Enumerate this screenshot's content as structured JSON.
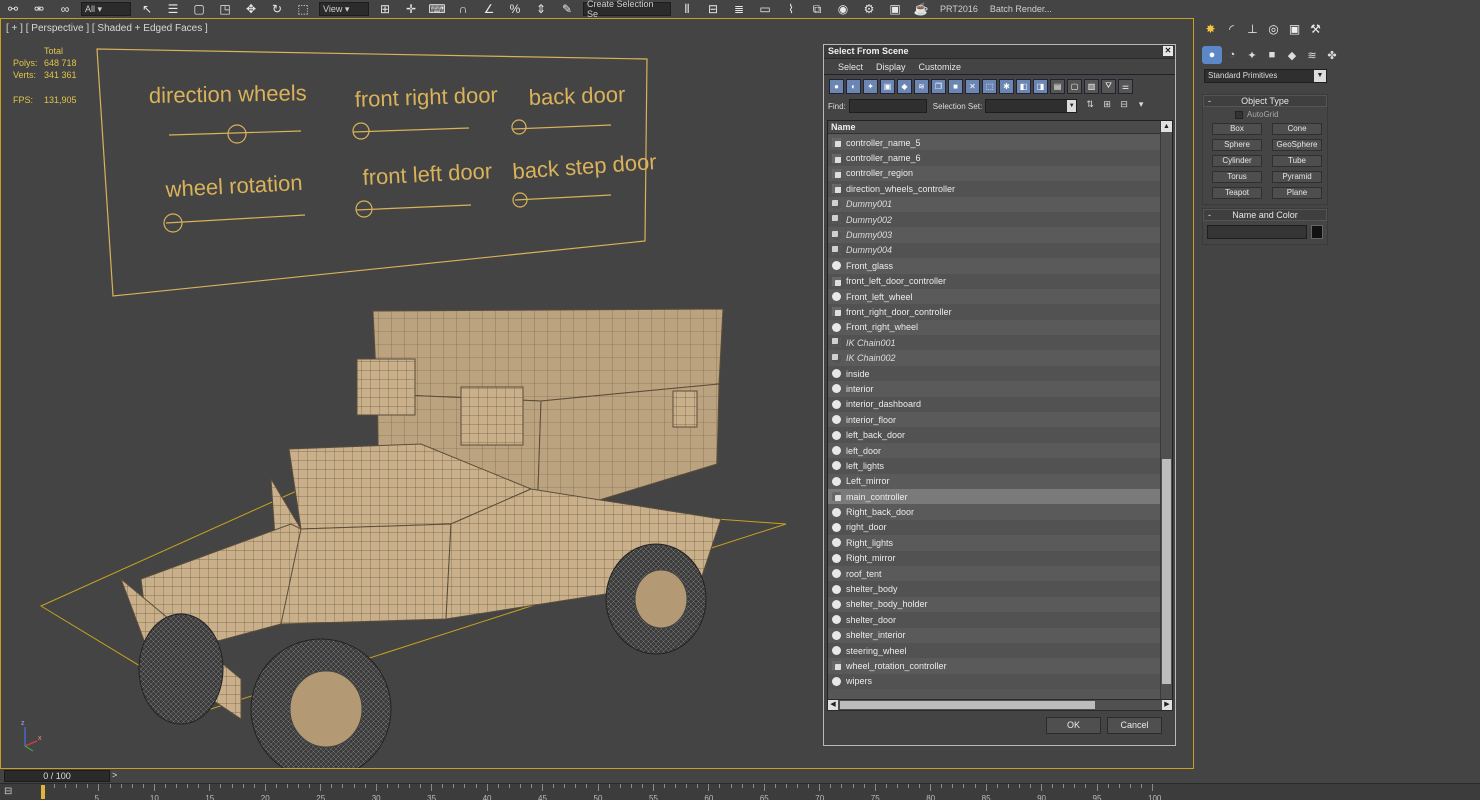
{
  "toolbar": {
    "view_dropdown": "View",
    "selection_set_placeholder": "Create Selection Se",
    "plugin_label": "PRT2016",
    "batch_render_label": "Batch Render..."
  },
  "viewport": {
    "label": "[ + ] [ Perspective ] [ Shaded + Edged Faces ]",
    "stats": {
      "total_label": "Total",
      "polys_label": "Polys:",
      "polys_value": "648 718",
      "verts_label": "Verts:",
      "verts_value": "341 361",
      "fps_label": "FPS:",
      "fps_value": "131,905"
    },
    "control_panel_labels": [
      "direction wheels",
      "front right door",
      "back door",
      "wheel rotation",
      "front left door",
      "back step door"
    ],
    "axis_labels": {
      "z": "z",
      "x": "x"
    }
  },
  "time_slider": {
    "frame_display": "0 / 100",
    "next_arrow": ">",
    "ticks": [
      "5",
      "10",
      "15",
      "20",
      "25",
      "30",
      "35",
      "40",
      "45",
      "50",
      "55",
      "60",
      "65",
      "70",
      "75",
      "80",
      "85",
      "90",
      "95",
      "100"
    ]
  },
  "command_panel": {
    "category_dropdown": "Standard Primitives",
    "object_type_title": "Object Type",
    "autogrid_label": "AutoGrid",
    "primitives": [
      "Box",
      "Cone",
      "Sphere",
      "GeoSphere",
      "Cylinder",
      "Tube",
      "Torus",
      "Pyramid",
      "Teapot",
      "Plane"
    ],
    "name_color_title": "Name and Color",
    "color_swatch": "#111111"
  },
  "dialog": {
    "title": "Select From Scene",
    "menu": [
      "Select",
      "Display",
      "Customize"
    ],
    "find_label": "Find:",
    "find_value": "",
    "selection_set_label": "Selection Set:",
    "column_header": "Name",
    "items": [
      {
        "name": "controller_name_5",
        "type": "ctrl"
      },
      {
        "name": "controller_name_6",
        "type": "ctrl"
      },
      {
        "name": "controller_region",
        "type": "ctrl"
      },
      {
        "name": "direction_wheels_controller",
        "type": "ctrl"
      },
      {
        "name": "Dummy001",
        "type": "dummy"
      },
      {
        "name": "Dummy002",
        "type": "dummy"
      },
      {
        "name": "Dummy003",
        "type": "dummy"
      },
      {
        "name": "Dummy004",
        "type": "dummy"
      },
      {
        "name": "Front_glass",
        "type": "mesh"
      },
      {
        "name": "front_left_door_controller",
        "type": "ctrl"
      },
      {
        "name": "Front_left_wheel",
        "type": "mesh"
      },
      {
        "name": "front_right_door_controller",
        "type": "ctrl"
      },
      {
        "name": "Front_right_wheel",
        "type": "mesh"
      },
      {
        "name": "IK Chain001",
        "type": "dummy"
      },
      {
        "name": "IK Chain002",
        "type": "dummy"
      },
      {
        "name": "inside",
        "type": "mesh"
      },
      {
        "name": "interior",
        "type": "mesh"
      },
      {
        "name": "interior_dashboard",
        "type": "mesh"
      },
      {
        "name": "interior_floor",
        "type": "mesh"
      },
      {
        "name": "left_back_door",
        "type": "mesh"
      },
      {
        "name": "left_door",
        "type": "mesh"
      },
      {
        "name": "left_lights",
        "type": "mesh"
      },
      {
        "name": "Left_mirror",
        "type": "mesh"
      },
      {
        "name": "main_controller",
        "type": "ctrl",
        "selected": true
      },
      {
        "name": "Right_back_door",
        "type": "mesh"
      },
      {
        "name": "right_door",
        "type": "mesh"
      },
      {
        "name": "Right_lights",
        "type": "mesh"
      },
      {
        "name": "Right_mirror",
        "type": "mesh"
      },
      {
        "name": "roof_tent",
        "type": "mesh"
      },
      {
        "name": "shelter_body",
        "type": "mesh"
      },
      {
        "name": "shelter_body_holder",
        "type": "mesh"
      },
      {
        "name": "shelter_door",
        "type": "mesh"
      },
      {
        "name": "shelter_interior",
        "type": "mesh"
      },
      {
        "name": "steering_wheel",
        "type": "mesh"
      },
      {
        "name": "wheel_rotation_controller",
        "type": "ctrl"
      },
      {
        "name": "wipers",
        "type": "mesh"
      }
    ],
    "ok_label": "OK",
    "cancel_label": "Cancel"
  },
  "colors": {
    "viewport_border": "#c8a21e",
    "stats_text": "#e0c44a",
    "panel_text": "#d9b25a",
    "selection_row": "#7a7a7a",
    "active_tab": "#5c88c9"
  }
}
